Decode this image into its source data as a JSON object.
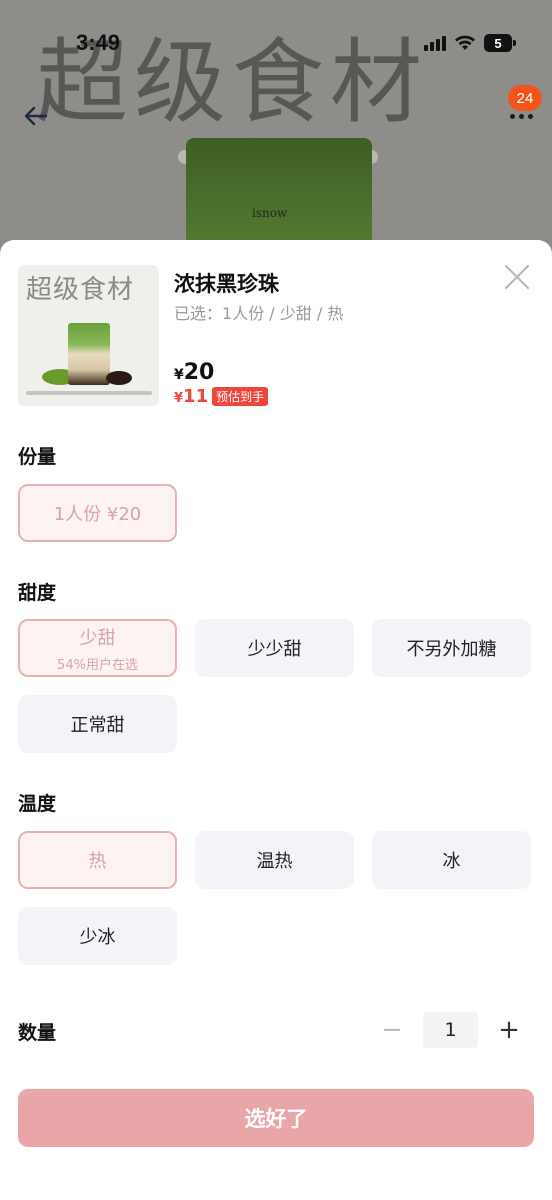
{
  "status_bar": {
    "time": "3:49",
    "battery": "5"
  },
  "background": {
    "watermark": "超级食材",
    "cup_text": "isnow",
    "badge_count": "24"
  },
  "product": {
    "thumb_title": "超级食材",
    "name": "浓抹黑珍珠",
    "selected_prefix": "已选：",
    "selected_value": "1人份 / 少甜 / 热",
    "currency": "¥",
    "price": "20",
    "est_price": "11",
    "est_tag": "预估到手"
  },
  "sections": {
    "portion": {
      "title": "份量",
      "options": [
        {
          "label": "1人份  ¥20",
          "selected": true
        }
      ]
    },
    "sweetness": {
      "title": "甜度",
      "options": [
        {
          "label": "少甜",
          "sub": "54%用户在选",
          "selected": true
        },
        {
          "label": "少少甜",
          "selected": false
        },
        {
          "label": "不另外加糖",
          "selected": false
        },
        {
          "label": "正常甜",
          "selected": false
        }
      ]
    },
    "temperature": {
      "title": "温度",
      "options": [
        {
          "label": "热",
          "selected": true
        },
        {
          "label": "温热",
          "selected": false
        },
        {
          "label": "冰",
          "selected": false
        },
        {
          "label": "少冰",
          "selected": false
        }
      ]
    }
  },
  "quantity": {
    "label": "数量",
    "minus": "−",
    "value": "1",
    "plus": "+"
  },
  "confirm_label": "选好了",
  "colors": {
    "accent": "#f0453a",
    "selected_border": "#e8b2b2",
    "confirm_bg": "#e9a6a9",
    "badge": "#f2541b"
  }
}
